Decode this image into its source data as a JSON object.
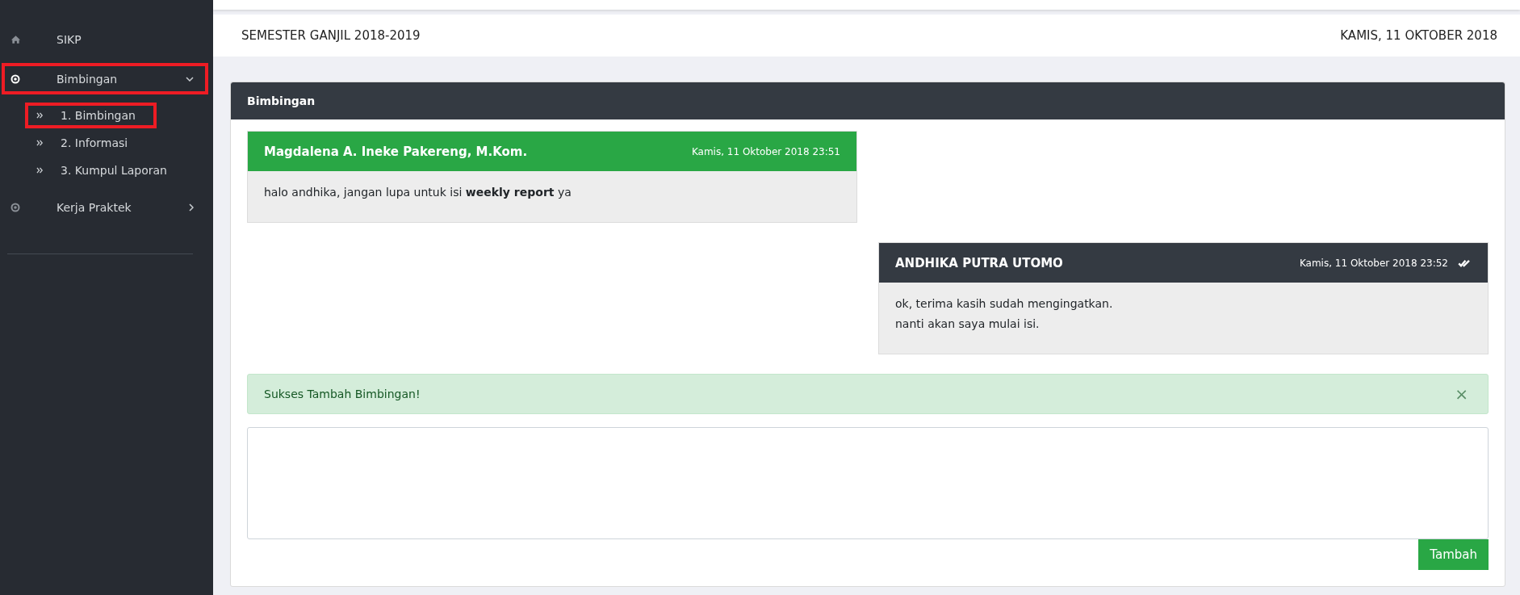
{
  "sidebar": {
    "items": [
      {
        "label": "SIKP",
        "kind": "link",
        "highlighted": false
      },
      {
        "label": "Bimbingan",
        "kind": "group",
        "expanded": true,
        "highlighted": true,
        "children": [
          {
            "label": "1. Bimbingan",
            "highlighted": true
          },
          {
            "label": "2. Informasi",
            "highlighted": false
          },
          {
            "label": "3. Kumpul Laporan",
            "highlighted": false
          }
        ]
      },
      {
        "label": "Kerja Praktek",
        "kind": "group",
        "expanded": false,
        "highlighted": false
      }
    ]
  },
  "header": {
    "semester": "SEMESTER GANJIL 2018-2019",
    "date": "KAMIS, 11 OKTOBER 2018"
  },
  "panel": {
    "title": "Bimbingan",
    "messages": [
      {
        "kind": "incoming",
        "sender": "Magdalena A. Ineke Pakereng, M.Kom.",
        "time": "Kamis, 11 Oktober 2018 23:51",
        "read": false,
        "lines": [
          "halo andhika, jangan lupa untuk isi **weekly report** ya"
        ]
      },
      {
        "kind": "outgoing",
        "sender": "ANDHIKA PUTRA UTOMO",
        "time": "Kamis, 11 Oktober 2018 23:52",
        "read": true,
        "lines": [
          "ok, terima kasih sudah mengingatkan.",
          "nanti akan saya mulai isi."
        ]
      }
    ],
    "alert": {
      "text": "Sukses Tambah Bimbingan!",
      "close": "×"
    },
    "submit": "Tambah"
  }
}
